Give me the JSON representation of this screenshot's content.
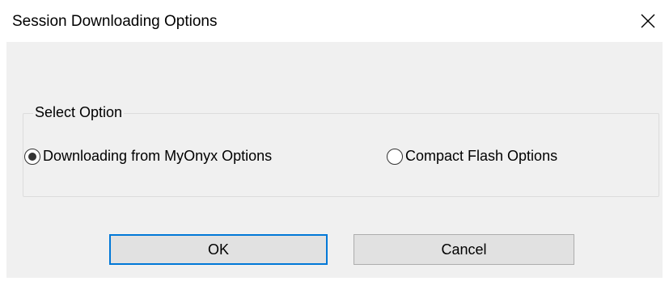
{
  "window": {
    "title": "Session Downloading Options",
    "close_icon": "close-icon"
  },
  "group": {
    "label": "Select Option",
    "options": [
      {
        "label": "Downloading from MyOnyx Options",
        "selected": true
      },
      {
        "label": "Compact Flash Options",
        "selected": false
      }
    ]
  },
  "buttons": {
    "ok_label": "OK",
    "cancel_label": "Cancel"
  },
  "colors": {
    "dialog_bg": "#f0f0f0",
    "default_button_border": "#0078d7",
    "button_bg": "#e1e1e1"
  }
}
